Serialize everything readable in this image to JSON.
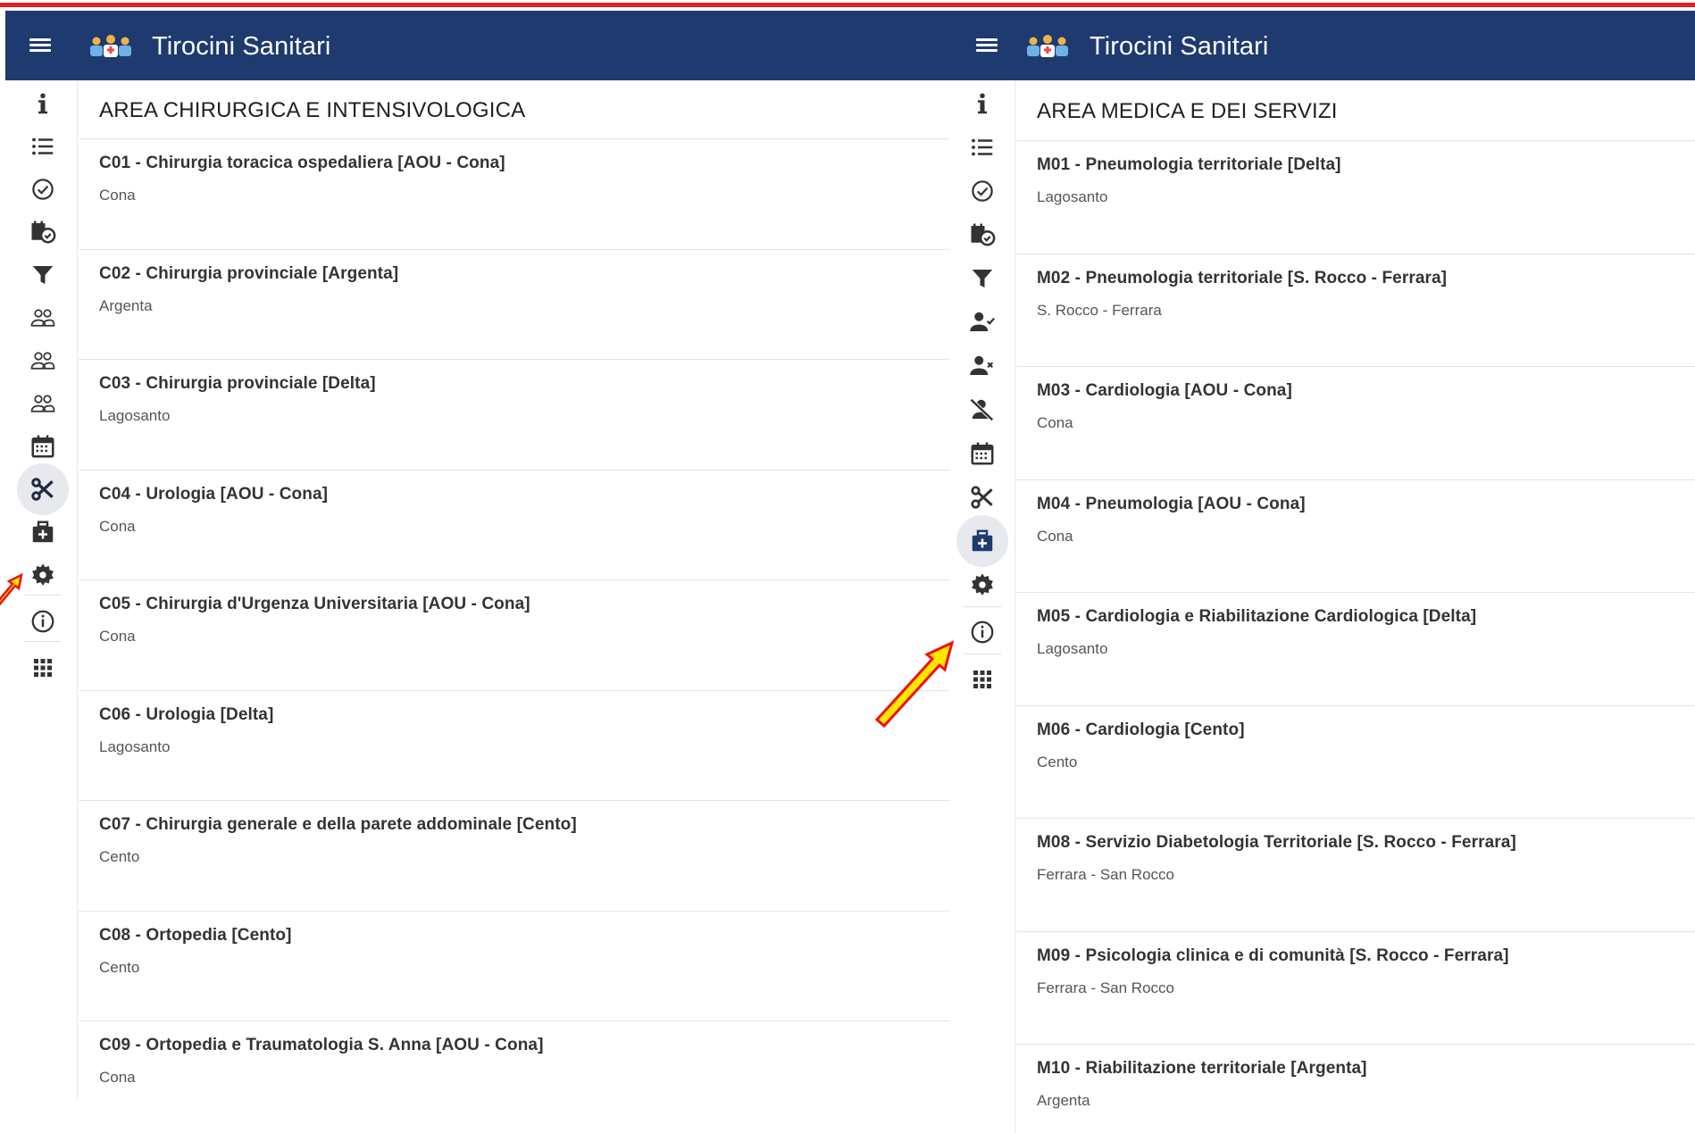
{
  "colors": {
    "appbar": "#1e3a6e",
    "rule": "#e02020",
    "active_icon_bg": "#e7e9ee",
    "icon": "#333333",
    "arrow_fill": "#ffe600",
    "arrow_outline": "#ee1111"
  },
  "panels": [
    {
      "app_title": "Tirocini Sanitari",
      "section_title": "AREA CHIRURGICA E INTENSIVOLOGICA",
      "rail_icons": [
        "info-icon",
        "list-icon",
        "check-circle-icon",
        "calendar-check-icon",
        "filter-icon",
        "people-icon",
        "people-icon",
        "people-icon",
        "calendar-icon",
        "scissors-icon",
        "medical-bag-icon",
        "gear-icon",
        "info-circle-icon",
        "apps-grid-icon"
      ],
      "active_icon": "scissors-icon",
      "items": [
        {
          "title": "C01 - Chirurgia toracica ospedaliera [AOU - Cona]",
          "location": "Cona"
        },
        {
          "title": "C02 - Chirurgia provinciale [Argenta]",
          "location": "Argenta"
        },
        {
          "title": "C03 - Chirurgia provinciale [Delta]",
          "location": "Lagosanto"
        },
        {
          "title": "C04 - Urologia [AOU - Cona]",
          "location": "Cona"
        },
        {
          "title": "C05 - Chirurgia d'Urgenza Universitaria [AOU - Cona]",
          "location": "Cona"
        },
        {
          "title": "C06 - Urologia [Delta]",
          "location": "Lagosanto"
        },
        {
          "title": "C07 - Chirurgia generale e della parete addominale [Cento]",
          "location": "Cento"
        },
        {
          "title": "C08 - Ortopedia [Cento]",
          "location": "Cento"
        },
        {
          "title": "C09 - Ortopedia e Traumatologia S. Anna [AOU - Cona]",
          "location": "Cona"
        }
      ]
    },
    {
      "app_title": "Tirocini Sanitari",
      "section_title": "AREA MEDICA E DEI SERVIZI",
      "rail_icons": [
        "info-icon",
        "list-icon",
        "check-circle-icon",
        "calendar-check-icon",
        "filter-icon",
        "person-check-icon",
        "person-remove-icon",
        "person-off-icon",
        "calendar-icon",
        "scissors-icon",
        "medical-bag-icon",
        "gear-icon",
        "info-circle-icon",
        "apps-grid-icon"
      ],
      "active_icon": "medical-bag-icon",
      "items": [
        {
          "title": "M01 - Pneumologia territoriale [Delta]",
          "location": "Lagosanto"
        },
        {
          "title": "M02 - Pneumologia territoriale [S. Rocco - Ferrara]",
          "location": "S. Rocco - Ferrara"
        },
        {
          "title": "M03 - Cardiologia [AOU - Cona]",
          "location": "Cona"
        },
        {
          "title": "M04 - Pneumologia [AOU - Cona]",
          "location": "Cona"
        },
        {
          "title": "M05 - Cardiologia e Riabilitazione Cardiologica [Delta]",
          "location": "Lagosanto"
        },
        {
          "title": "M06 - Cardiologia [Cento]",
          "location": "Cento"
        },
        {
          "title": "M08 - Servizio Diabetologia Territoriale [S. Rocco - Ferrara]",
          "location": "Ferrara - San Rocco"
        },
        {
          "title": "M09 - Psicologia clinica e di comunità [S. Rocco - Ferrara]",
          "location": "Ferrara - San Rocco"
        },
        {
          "title": "M10 - Riabilitazione territoriale [Argenta]",
          "location": "Argenta"
        }
      ]
    }
  ]
}
